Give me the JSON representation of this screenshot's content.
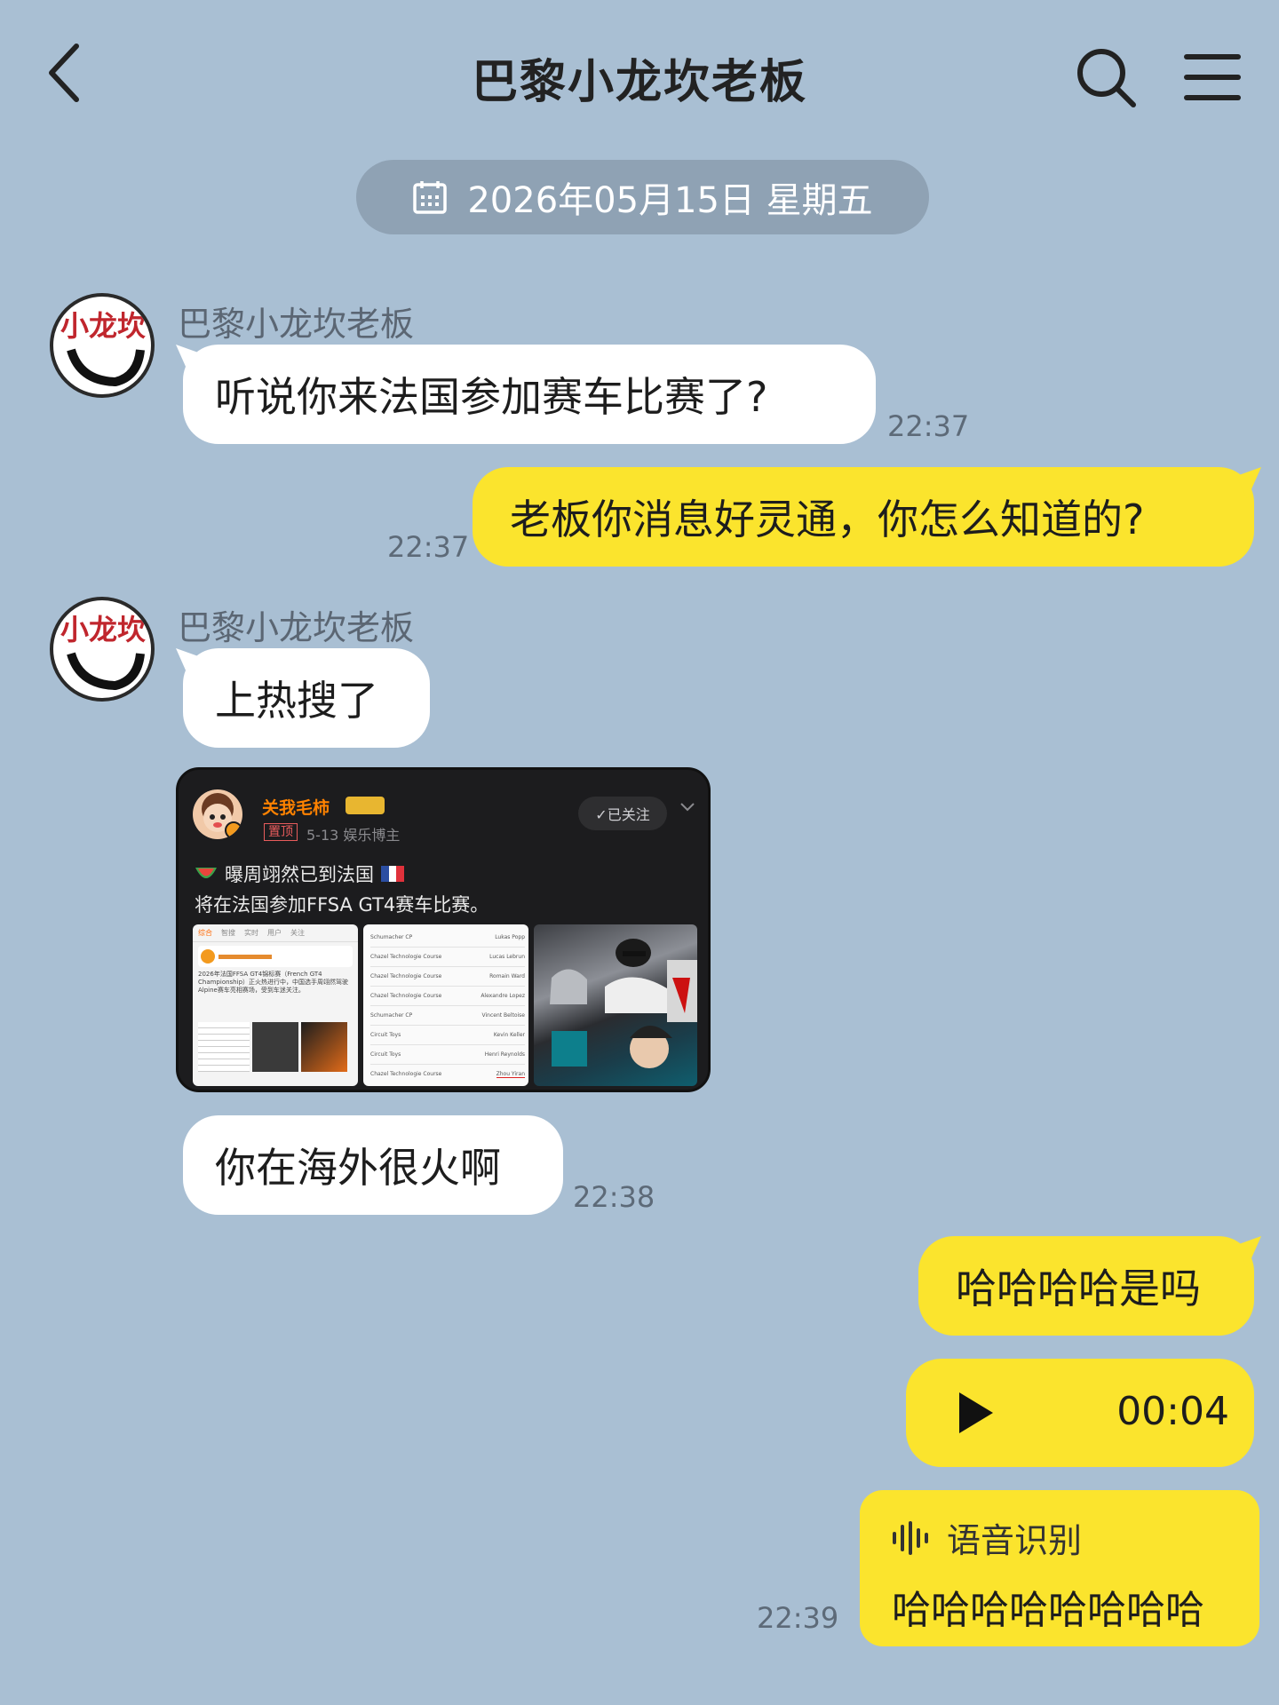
{
  "header": {
    "title": "巴黎小龙坎老板"
  },
  "date_pill": {
    "text": "2026年05月15日 星期五"
  },
  "avatar_text": "小龙坎",
  "messages": [
    {
      "sender": "巴黎小龙坎老板",
      "text": "听说你来法国参加赛车比赛了?",
      "time": "22:37"
    },
    {
      "text": "老板你消息好灵通，你怎么知道的?",
      "time": "22:37"
    },
    {
      "sender": "巴黎小龙坎老板",
      "text": "上热搜了"
    },
    {
      "text": "你在海外很火啊",
      "time": "22:38"
    },
    {
      "text": "哈哈哈哈是吗"
    },
    {
      "voice_duration": "00:04"
    },
    {
      "asr_label": "语音识别",
      "asr_text": "哈哈哈哈哈哈哈哈",
      "time": "22:39"
    }
  ],
  "shared_post": {
    "author": "关我毛柿",
    "badge": "置顶",
    "meta": "5-13  娱乐博主",
    "follow_label": "✓已关注",
    "line1": "曝周翊然已到法国",
    "line2": "将在法国参加FFSA GT4赛车比赛。",
    "thumb1_tabs": [
      "综合",
      "智搜",
      "实时",
      "用户",
      "关注"
    ],
    "thumb1_text": "2026年法国FFSA GT4锦标赛（French GT4 Championship）正火热进行中，中国选手周翊然驾驶Alpine赛车亮相赛场，受到车迷关注。",
    "thumb2_rows": [
      [
        "Schumacher CP",
        "Lukas Popp"
      ],
      [
        "Chazel Technologie Course",
        "Lucas Lebrun"
      ],
      [
        "Chazel Technologie Course",
        "Romain Ward"
      ],
      [
        "Chazel Technologie Course",
        "Alexandre Lopez"
      ],
      [
        "Schumacher CP",
        "Vincent Beltoise"
      ],
      [
        "Circuit Toys",
        "Kevin Keller"
      ],
      [
        "Circuit Toys",
        "Henri Reynolds"
      ],
      [
        "Chazel Technologie Course",
        "Zhou Yiran"
      ]
    ]
  },
  "colors": {
    "background": "#a9bfd3",
    "incoming_bubble": "#ffffff",
    "outgoing_bubble": "#fbe42d",
    "date_pill": "#8fa2b4"
  },
  "icons": [
    "back-icon",
    "search-icon",
    "menu-icon",
    "calendar-icon",
    "play-icon",
    "soundwave-icon"
  ]
}
